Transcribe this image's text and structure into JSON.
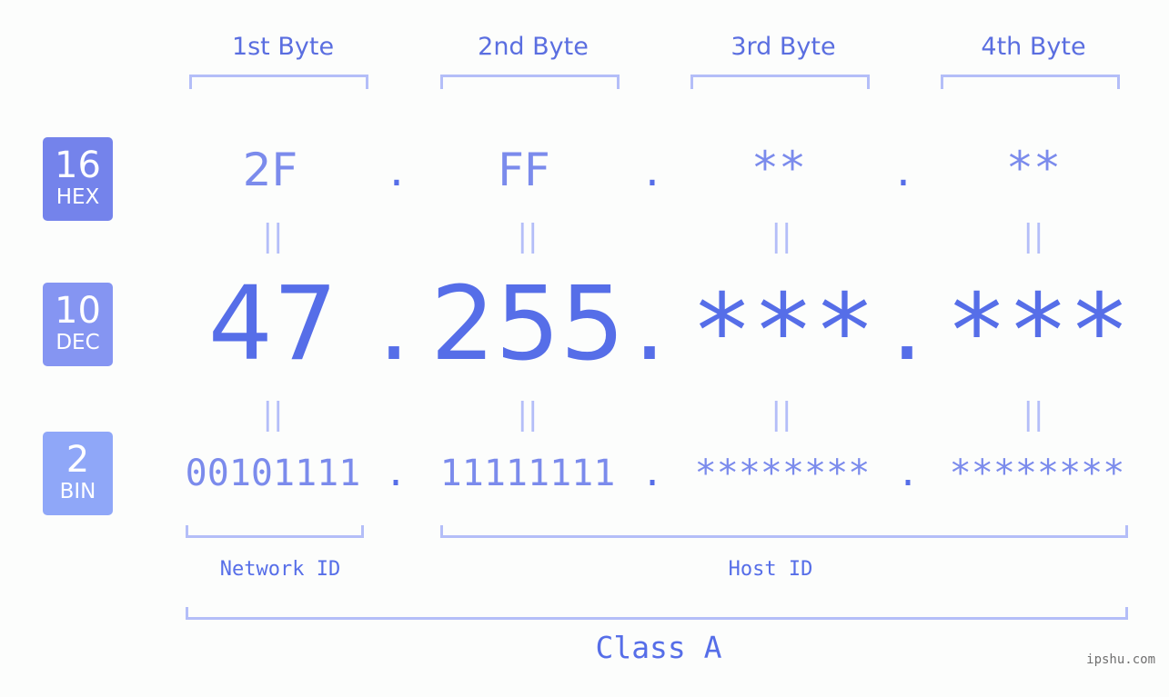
{
  "bases": [
    {
      "number": "16",
      "label": "HEX",
      "color": "#7483eb"
    },
    {
      "number": "10",
      "label": "DEC",
      "color": "#8595f2"
    },
    {
      "number": "2",
      "label": "BIN",
      "color": "#8fa7f8"
    }
  ],
  "byte_headers": [
    "1st Byte",
    "2nd Byte",
    "3rd Byte",
    "4th Byte"
  ],
  "hex": [
    "2F",
    "FF",
    "**",
    "**"
  ],
  "dec": [
    "47",
    "255",
    "***",
    "***"
  ],
  "bin": [
    "00101111",
    "11111111",
    "********",
    "********"
  ],
  "separator": ".",
  "equals": "||",
  "network_id_label": "Network ID",
  "host_id_label": "Host ID",
  "class_label": "Class A",
  "watermark": "ipshu.com",
  "colors": {
    "accent": "#566ee8",
    "light": "#7b8bec",
    "bracket": "#b4bef8"
  }
}
